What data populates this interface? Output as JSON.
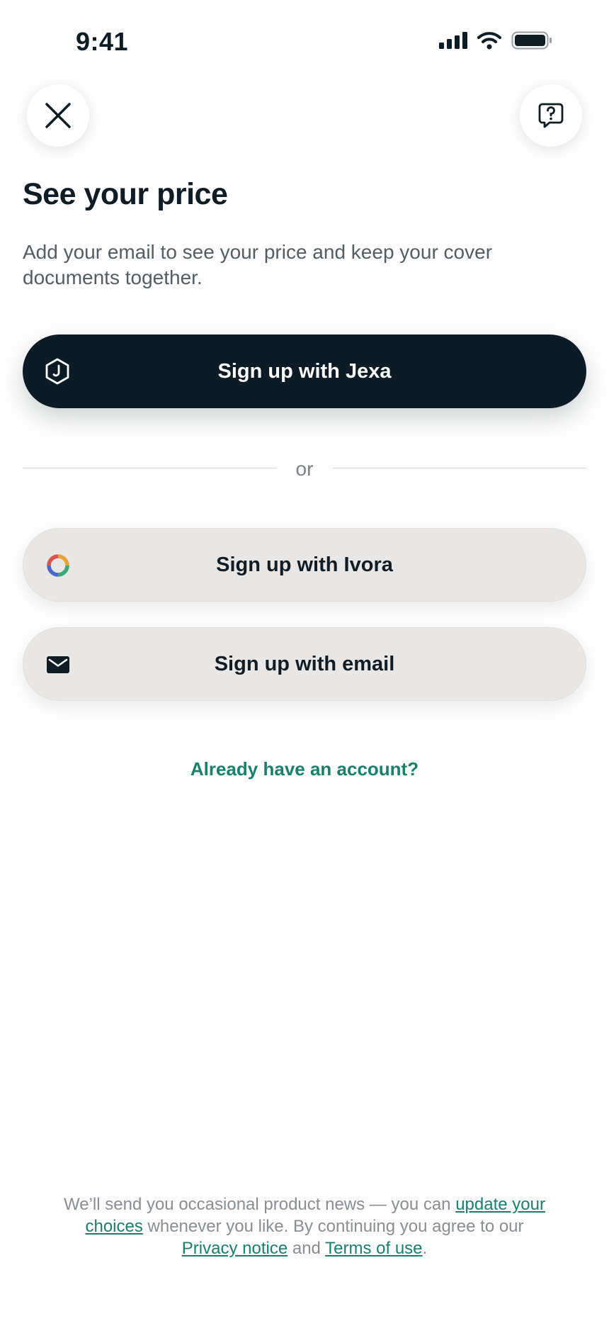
{
  "status_bar": {
    "time": "9:41"
  },
  "header": {
    "close_icon": "close-icon",
    "help_icon": "help-chat-icon"
  },
  "content": {
    "title": "See your price",
    "subtitle": "Add your email to see your price and keep your cover documents together."
  },
  "buttons": {
    "jexa": {
      "label": "Sign up with Jexa",
      "icon": "jexa-logo-icon"
    },
    "divider": "or",
    "ivora": {
      "label": "Sign up with Ivora",
      "icon": "ivora-logo-icon"
    },
    "email": {
      "label": "Sign up with email",
      "icon": "envelope-icon"
    }
  },
  "signin_link": "Already have an account?",
  "footer": {
    "part1": "We’ll send you occasional product news — you can ",
    "link_update": "update your choices",
    "part2": " whenever you like. By continuing you agree to our ",
    "link_privacy": "Privacy notice",
    "part3": " and ",
    "link_terms": "Terms of use",
    "part4": "."
  },
  "colors": {
    "primary_dark": "#0d1c24",
    "secondary_button": "#e8e7e5",
    "link": "#1a7f6b",
    "background": "#fdfdfd"
  }
}
